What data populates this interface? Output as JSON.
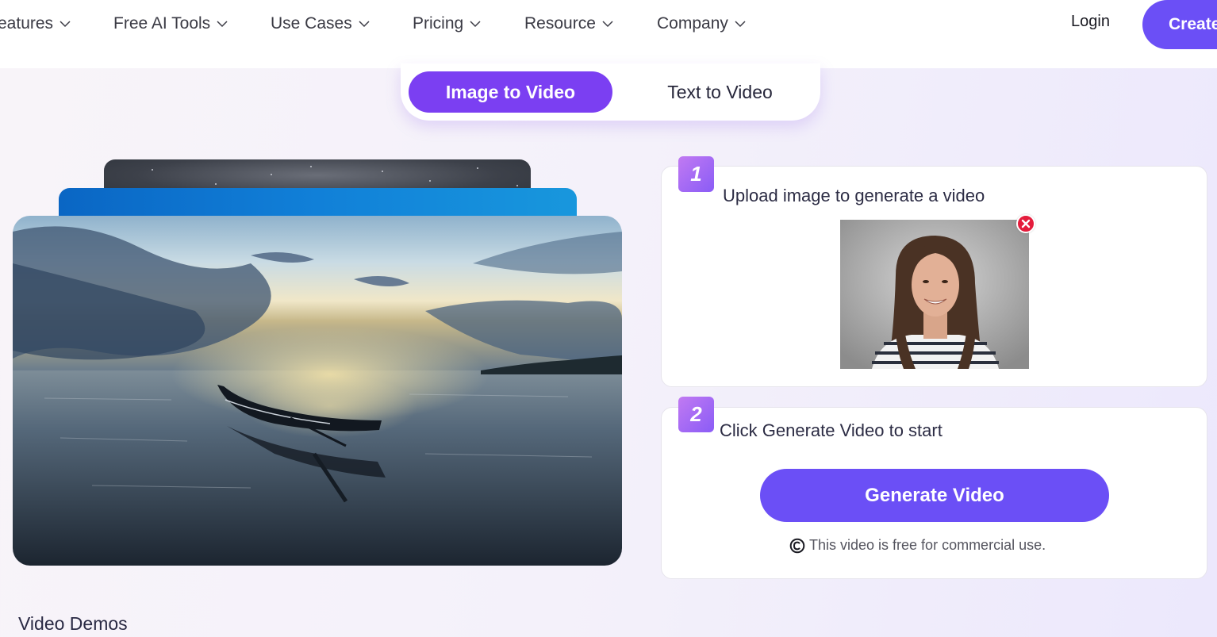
{
  "header": {
    "nav": [
      {
        "label": "eatures",
        "icon": "chevron-down-icon"
      },
      {
        "label": "Free AI Tools",
        "icon": "chevron-down-icon"
      },
      {
        "label": "Use Cases",
        "icon": "chevron-down-icon"
      },
      {
        "label": "Pricing",
        "icon": "chevron-down-icon"
      },
      {
        "label": "Resource",
        "icon": "chevron-down-icon"
      },
      {
        "label": "Company",
        "icon": "chevron-down-icon"
      }
    ],
    "login_label": "Login",
    "create_label": "Create"
  },
  "mode_switch": {
    "tabs": [
      {
        "label": "Image to Video",
        "active": true
      },
      {
        "label": "Text to Video",
        "active": false
      }
    ]
  },
  "preview": {
    "main_image": "sunset-boat-on-calm-sea",
    "stacked_images": [
      "starry-night-sky",
      "blue-sky"
    ]
  },
  "steps": [
    {
      "number": "1",
      "title": "Upload image to generate a video",
      "uploaded_image": "smiling-woman-portrait",
      "remove_icon": "close-circle-icon"
    },
    {
      "number": "2",
      "title": "Click Generate Video to start"
    }
  ],
  "generate_button_label": "Generate Video",
  "license_note": {
    "icon": "copyright-icon",
    "text": "This video is free for commercial use."
  },
  "demos_title": "Video Demos",
  "colors": {
    "primary": "#6b4ff6",
    "active_tab": "#7b3ff2",
    "remove": "#e41c3c",
    "badge_gradient_start": "#c17af2",
    "badge_gradient_end": "#8a5cf6"
  }
}
